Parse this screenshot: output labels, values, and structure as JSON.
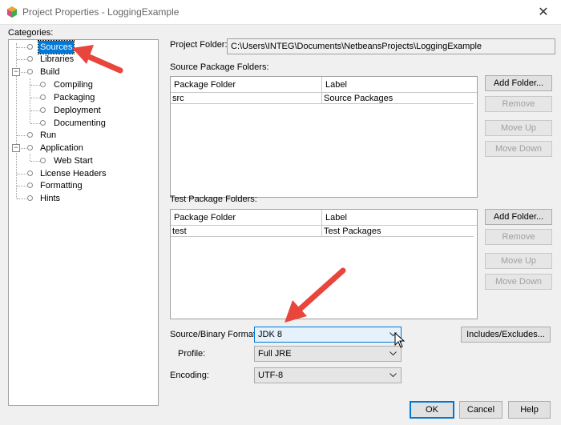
{
  "window": {
    "title": "Project Properties - LoggingExample",
    "close_glyph": "✕"
  },
  "categories_label": "Categories:",
  "tree": {
    "expander_minus": "−",
    "items": [
      {
        "label": "Sources",
        "selected": true
      },
      {
        "label": "Libraries"
      },
      {
        "label": "Build"
      },
      {
        "label": "Compiling"
      },
      {
        "label": "Packaging"
      },
      {
        "label": "Deployment"
      },
      {
        "label": "Documenting"
      },
      {
        "label": "Run"
      },
      {
        "label": "Application"
      },
      {
        "label": "Web Start"
      },
      {
        "label": "License Headers"
      },
      {
        "label": "Formatting"
      },
      {
        "label": "Hints"
      }
    ]
  },
  "project_folder": {
    "label": "Project Folder:",
    "value": "C:\\Users\\INTEG\\Documents\\NetbeansProjects\\LoggingExample"
  },
  "source_packages": {
    "label": "Source Package Folders:",
    "columns": [
      "Package Folder",
      "Label"
    ],
    "rows": [
      [
        "src",
        "Source Packages"
      ]
    ],
    "buttons": {
      "add": "Add Folder...",
      "remove": "Remove",
      "up": "Move Up",
      "down": "Move Down"
    }
  },
  "test_packages": {
    "label": "Test Package Folders:",
    "columns": [
      "Package Folder",
      "Label"
    ],
    "rows": [
      [
        "test",
        "Test Packages"
      ]
    ],
    "buttons": {
      "add": "Add Folder...",
      "remove": "Remove",
      "up": "Move Up",
      "down": "Move Down"
    }
  },
  "format": {
    "label": "Source/Binary Format:",
    "value": "JDK 8"
  },
  "includes_excludes": "Includes/Excludes...",
  "profile": {
    "label": "Profile:",
    "value": "Full JRE"
  },
  "encoding": {
    "label": "Encoding:",
    "value": "UTF-8"
  },
  "footer": {
    "ok": "OK",
    "cancel": "Cancel",
    "help": "Help"
  },
  "colors": {
    "arrow": "#e8453c",
    "selection": "#0078d7"
  },
  "icons": {
    "app": "netbeans-cube-icon",
    "chevron": "chevron-down-icon",
    "cursor": "mouse-pointer-icon"
  }
}
